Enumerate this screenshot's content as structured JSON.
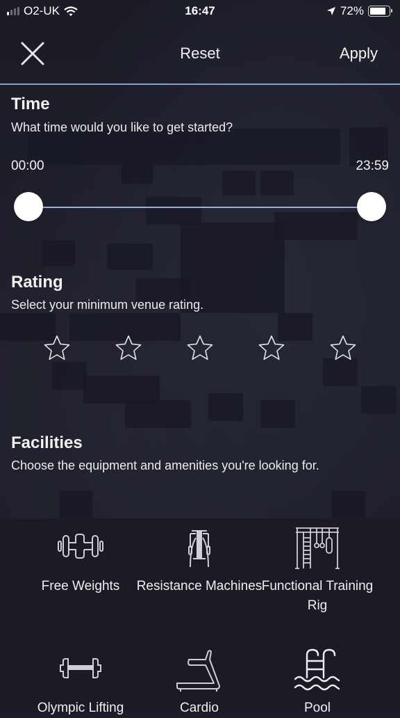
{
  "status_bar": {
    "carrier": "O2-UK",
    "time": "16:47",
    "battery_percent": "72%",
    "signal_bars_active": 1,
    "signal_bars_total": 4,
    "battery_level": 0.72
  },
  "header": {
    "close_icon": "close-icon",
    "reset_label": "Reset",
    "apply_label": "Apply"
  },
  "time_section": {
    "title": "Time",
    "subtitle": "What time would you like to get started?",
    "min_label": "00:00",
    "max_label": "23:59",
    "range_start_fraction": 0.0,
    "range_end_fraction": 1.0
  },
  "rating_section": {
    "title": "Rating",
    "subtitle": "Select your minimum venue rating.",
    "stars_total": 5,
    "stars_selected": 0
  },
  "facilities_section": {
    "title": "Facilities",
    "subtitle": "Choose the equipment and amenities you're looking for.",
    "items": [
      {
        "label": "Free Weights",
        "icon": "dumbbell-icon"
      },
      {
        "label": "Resistance Machines",
        "icon": "resistance-machine-icon"
      },
      {
        "label": "Functional Training Rig",
        "icon": "training-rig-icon"
      },
      {
        "label": "Olympic Lifting",
        "icon": "barbell-icon"
      },
      {
        "label": "Cardio",
        "icon": "treadmill-icon"
      },
      {
        "label": "Pool",
        "icon": "pool-icon"
      }
    ]
  },
  "colors": {
    "background": "#1c1d28",
    "divider": "#8aa0c8",
    "slider_track": "#9ab0dc",
    "text": "#f2f2f2"
  }
}
